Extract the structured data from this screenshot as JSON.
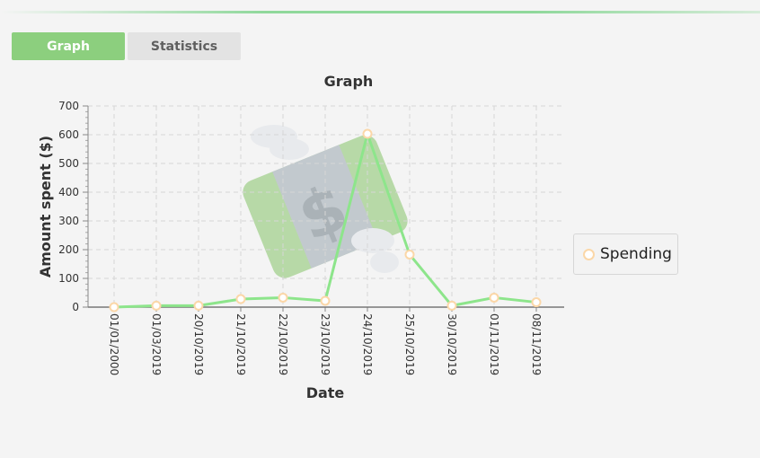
{
  "tabs": [
    {
      "label": "Graph",
      "active": true
    },
    {
      "label": "Statistics",
      "active": false
    }
  ],
  "legend": {
    "label": "Spending"
  },
  "colors": {
    "accent": "#8ccf7e",
    "line": "#8de58b",
    "marker": "#fbd7a8",
    "grid": "#d6d6d6"
  },
  "watermark_icon": "flying-money-icon",
  "chart_data": {
    "type": "line",
    "title": "Graph",
    "xlabel": "Date",
    "ylabel": "Amount spent ($)",
    "ylim": [
      0,
      700
    ],
    "yticks": [
      0,
      100,
      200,
      300,
      400,
      500,
      600,
      700
    ],
    "categories": [
      "01/01/2000",
      "01/03/2019",
      "20/10/2019",
      "21/10/2019",
      "22/10/2019",
      "23/10/2019",
      "24/10/2019",
      "25/10/2019",
      "30/10/2019",
      "01/11/2019",
      "08/11/2019"
    ],
    "series": [
      {
        "name": "Spending",
        "values": [
          0,
          5,
          5,
          28,
          33,
          22,
          603,
          183,
          5,
          33,
          17
        ]
      }
    ],
    "grid": true,
    "legend_position": "right"
  }
}
